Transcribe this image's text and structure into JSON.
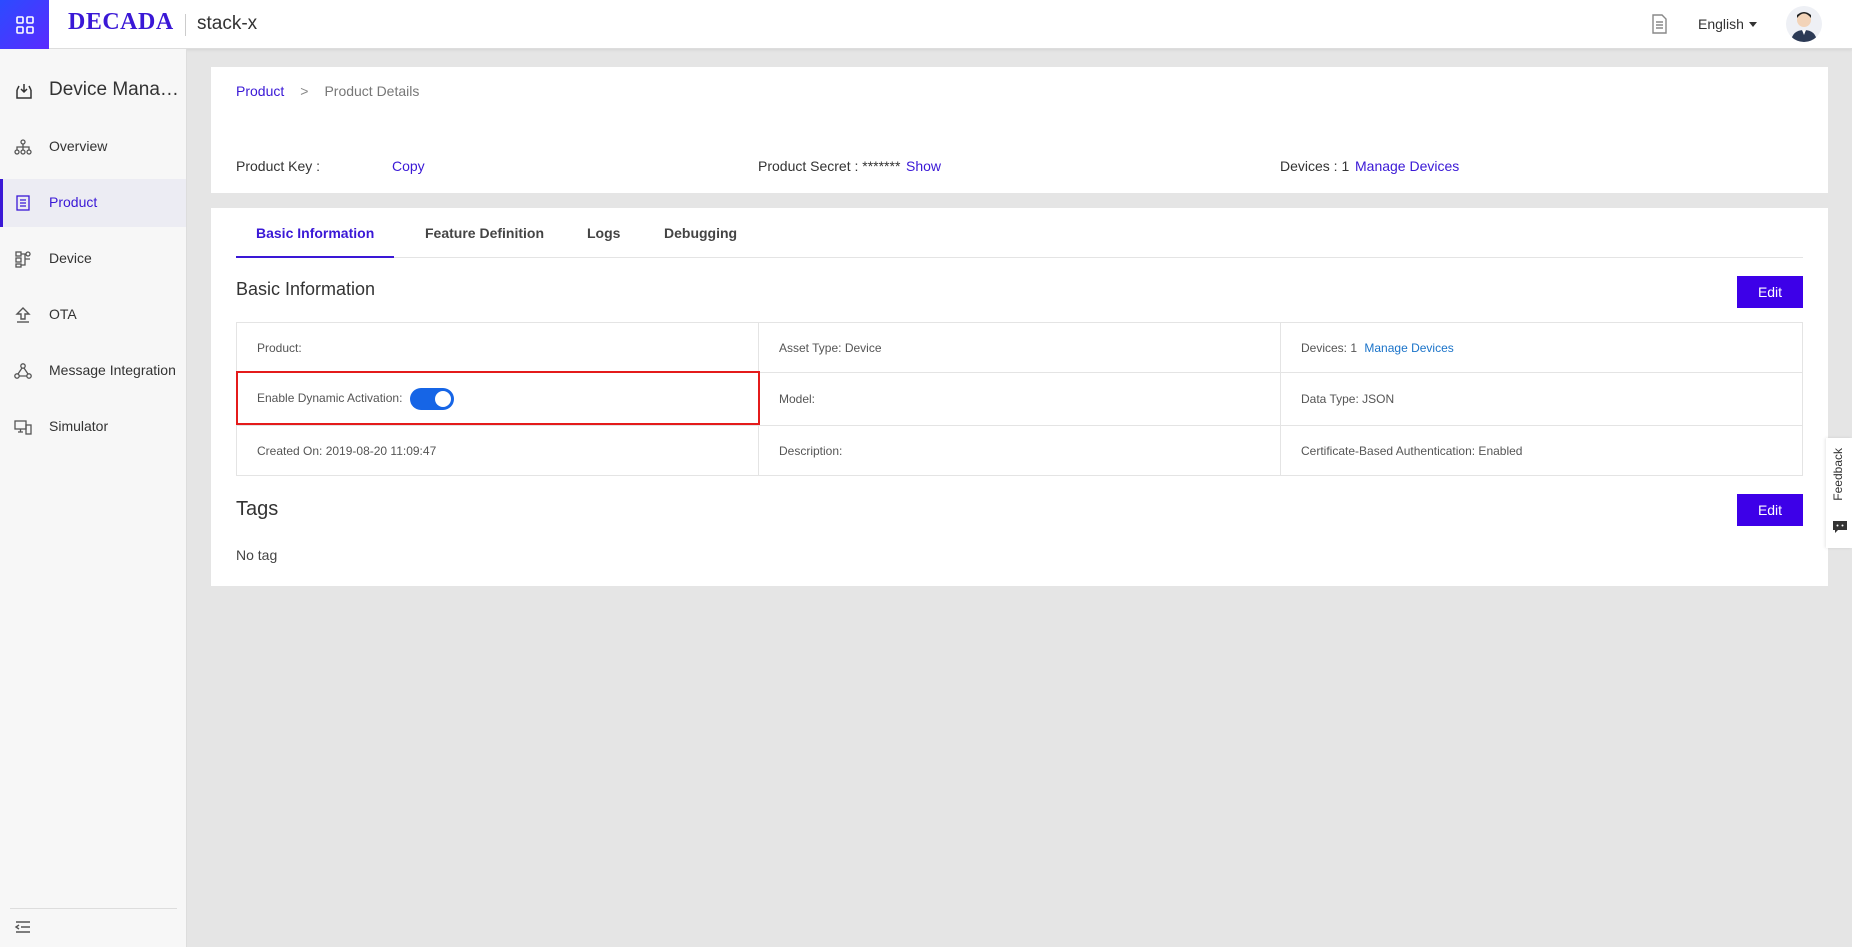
{
  "topbar": {
    "logo": "DECADA",
    "project": "stack-x",
    "language": "English"
  },
  "sidebar": {
    "title": "Device Management",
    "items": [
      {
        "label": "Overview",
        "icon": "sitemap-icon"
      },
      {
        "label": "Product",
        "icon": "product-icon",
        "active": true
      },
      {
        "label": "Device",
        "icon": "device-icon"
      },
      {
        "label": "OTA",
        "icon": "upload-icon"
      },
      {
        "label": "Message Integration",
        "icon": "share-nodes-icon"
      },
      {
        "label": "Simulator",
        "icon": "simulator-icon"
      }
    ]
  },
  "breadcrumb": {
    "parent": "Product",
    "separator": ">",
    "current": "Product Details"
  },
  "summary": {
    "product_key_label": "Product Key :",
    "copy_label": "Copy",
    "product_secret_label": "Product Secret : *******",
    "show_label": "Show",
    "devices_label": "Devices : 1",
    "manage_devices_label": "Manage Devices"
  },
  "tabs": [
    "Basic Information",
    "Feature Definition",
    "Logs",
    "Debugging"
  ],
  "basic_info": {
    "title": "Basic Information",
    "edit_label": "Edit",
    "product": "Product:",
    "asset_type": "Asset Type: Device",
    "devices": "Devices: 1",
    "manage_devices": "Manage Devices",
    "dynamic_activation": "Enable Dynamic Activation:",
    "model": "Model:",
    "data_type": "Data Type: JSON",
    "created_on": "Created On: 2019-08-20 11:09:47",
    "description": "Description:",
    "cert_auth": "Certificate-Based Authentication: Enabled"
  },
  "tags": {
    "title": "Tags",
    "edit_label": "Edit",
    "empty": "No tag"
  },
  "feedback_label": "Feedback",
  "colors": {
    "accent": "#3a18d6",
    "button": "#3d00e8",
    "toggle_on": "#1665e6",
    "highlight": "#e41b1b"
  }
}
